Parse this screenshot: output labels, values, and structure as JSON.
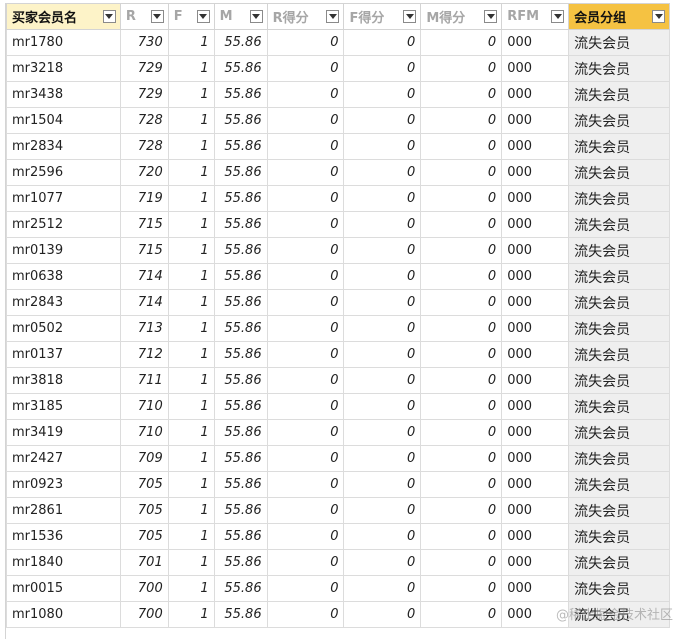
{
  "headers": [
    "买家会员名",
    "R",
    "F",
    "M",
    "R得分",
    "F得分",
    "M得分",
    "RFM",
    "会员分组"
  ],
  "rows": [
    [
      "mr1780",
      "730",
      "1",
      "55.86",
      "0",
      "0",
      "0",
      "000",
      "流失会员"
    ],
    [
      "mr3218",
      "729",
      "1",
      "55.86",
      "0",
      "0",
      "0",
      "000",
      "流失会员"
    ],
    [
      "mr3438",
      "729",
      "1",
      "55.86",
      "0",
      "0",
      "0",
      "000",
      "流失会员"
    ],
    [
      "mr1504",
      "728",
      "1",
      "55.86",
      "0",
      "0",
      "0",
      "000",
      "流失会员"
    ],
    [
      "mr2834",
      "728",
      "1",
      "55.86",
      "0",
      "0",
      "0",
      "000",
      "流失会员"
    ],
    [
      "mr2596",
      "720",
      "1",
      "55.86",
      "0",
      "0",
      "0",
      "000",
      "流失会员"
    ],
    [
      "mr1077",
      "719",
      "1",
      "55.86",
      "0",
      "0",
      "0",
      "000",
      "流失会员"
    ],
    [
      "mr2512",
      "715",
      "1",
      "55.86",
      "0",
      "0",
      "0",
      "000",
      "流失会员"
    ],
    [
      "mr0139",
      "715",
      "1",
      "55.86",
      "0",
      "0",
      "0",
      "000",
      "流失会员"
    ],
    [
      "mr0638",
      "714",
      "1",
      "55.86",
      "0",
      "0",
      "0",
      "000",
      "流失会员"
    ],
    [
      "mr2843",
      "714",
      "1",
      "55.86",
      "0",
      "0",
      "0",
      "000",
      "流失会员"
    ],
    [
      "mr0502",
      "713",
      "1",
      "55.86",
      "0",
      "0",
      "0",
      "000",
      "流失会员"
    ],
    [
      "mr0137",
      "712",
      "1",
      "55.86",
      "0",
      "0",
      "0",
      "000",
      "流失会员"
    ],
    [
      "mr3818",
      "711",
      "1",
      "55.86",
      "0",
      "0",
      "0",
      "000",
      "流失会员"
    ],
    [
      "mr3185",
      "710",
      "1",
      "55.86",
      "0",
      "0",
      "0",
      "000",
      "流失会员"
    ],
    [
      "mr3419",
      "710",
      "1",
      "55.86",
      "0",
      "0",
      "0",
      "000",
      "流失会员"
    ],
    [
      "mr2427",
      "709",
      "1",
      "55.86",
      "0",
      "0",
      "0",
      "000",
      "流失会员"
    ],
    [
      "mr0923",
      "705",
      "1",
      "55.86",
      "0",
      "0",
      "0",
      "000",
      "流失会员"
    ],
    [
      "mr2861",
      "705",
      "1",
      "55.86",
      "0",
      "0",
      "0",
      "000",
      "流失会员"
    ],
    [
      "mr1536",
      "705",
      "1",
      "55.86",
      "0",
      "0",
      "0",
      "000",
      "流失会员"
    ],
    [
      "mr1840",
      "701",
      "1",
      "55.86",
      "0",
      "0",
      "0",
      "000",
      "流失会员"
    ],
    [
      "mr0015",
      "700",
      "1",
      "55.86",
      "0",
      "0",
      "0",
      "000",
      "流失会员"
    ],
    [
      "mr1080",
      "700",
      "1",
      "55.86",
      "0",
      "0",
      "0",
      "000",
      "流失会员"
    ]
  ],
  "watermark": "@稀土掘金技术社区",
  "colors": {
    "header_highlight": "#f5c242",
    "group_cell": "#efefef",
    "grid": "#dcdcdc"
  }
}
